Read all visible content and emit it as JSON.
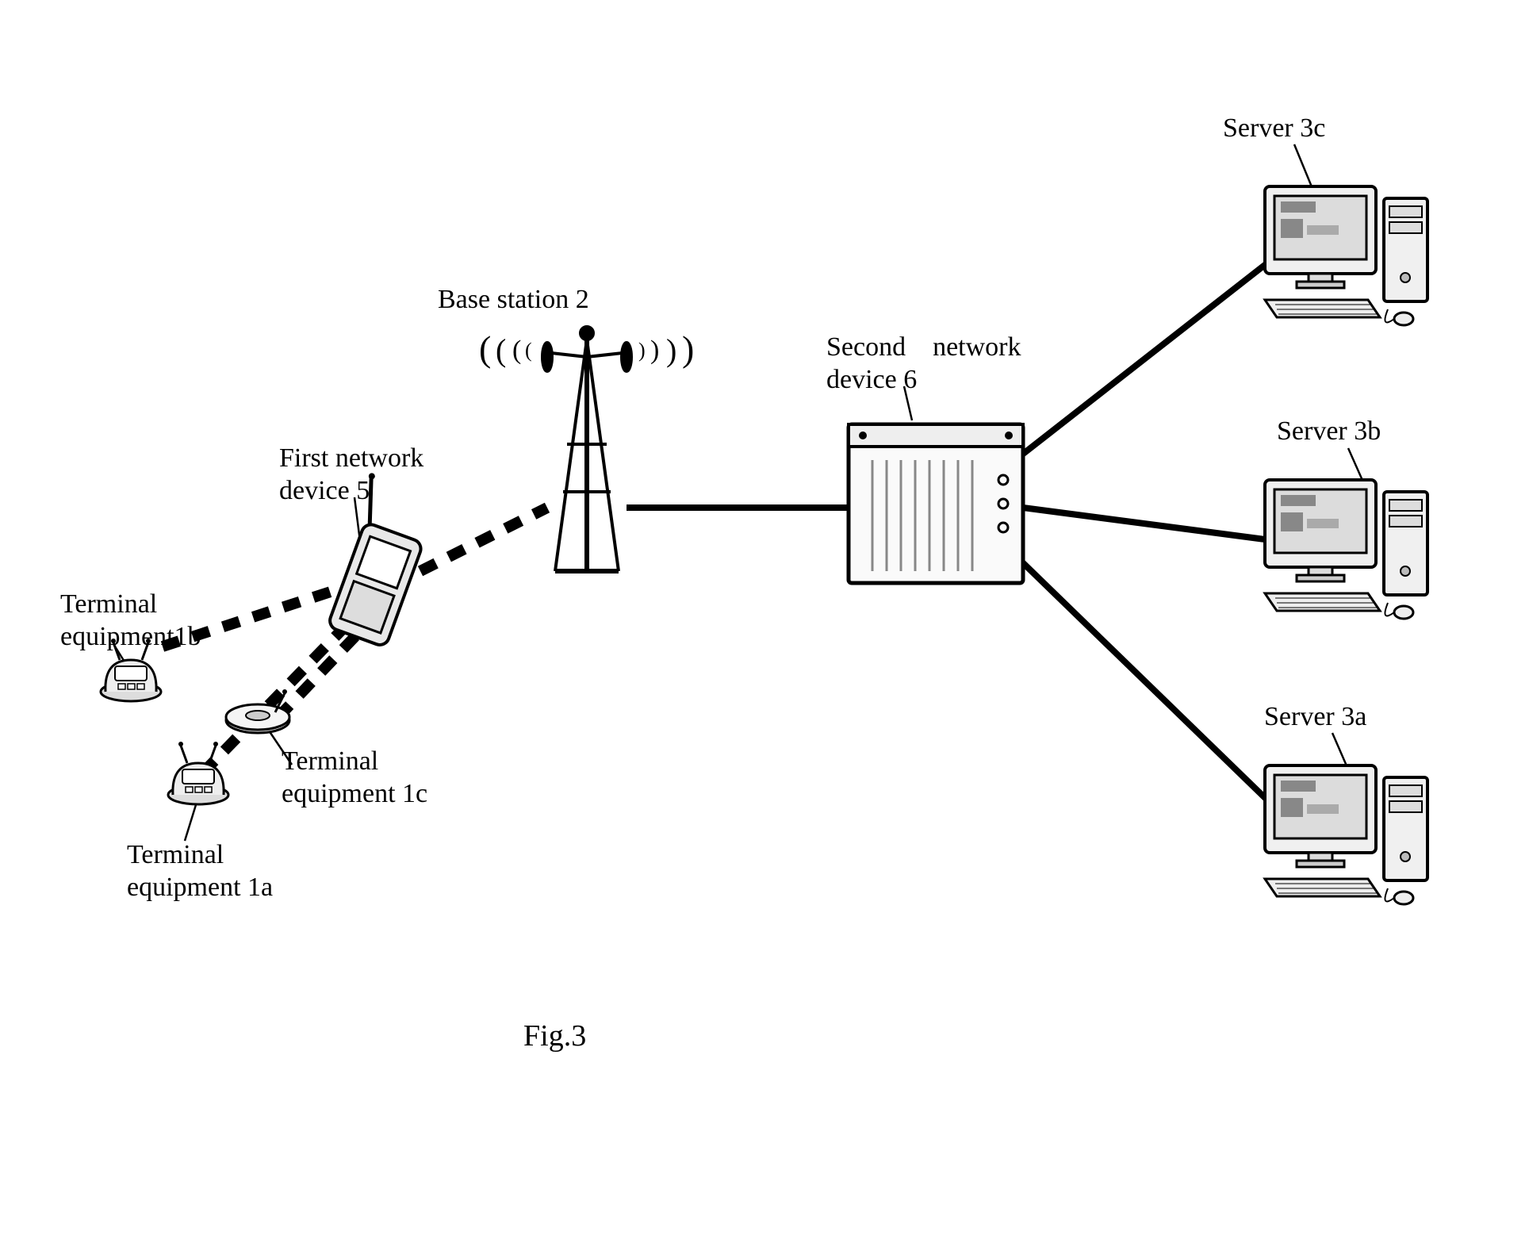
{
  "figure_caption": "Fig.3",
  "nodes": {
    "terminal_1a": {
      "label": "Terminal\nequipment 1a"
    },
    "terminal_1b": {
      "label": "Terminal\nequipment1b"
    },
    "terminal_1c": {
      "label": "Terminal\nequipment 1c"
    },
    "first_network_device": {
      "label": "First network\ndevice 5"
    },
    "base_station": {
      "label": "Base station 2"
    },
    "second_network_device": {
      "label": "Second    network\ndevice 6"
    },
    "server_3a": {
      "label": "Server 3a"
    },
    "server_3b": {
      "label": "Server 3b"
    },
    "server_3c": {
      "label": "Server 3c"
    }
  },
  "links": [
    {
      "from": "terminal_1a",
      "to": "first_network_device",
      "style": "dashed"
    },
    {
      "from": "terminal_1b",
      "to": "first_network_device",
      "style": "dashed"
    },
    {
      "from": "terminal_1c",
      "to": "first_network_device",
      "style": "dashed"
    },
    {
      "from": "first_network_device",
      "to": "base_station",
      "style": "dashed"
    },
    {
      "from": "base_station",
      "to": "second_network_device",
      "style": "solid"
    },
    {
      "from": "second_network_device",
      "to": "server_3a",
      "style": "solid"
    },
    {
      "from": "second_network_device",
      "to": "server_3b",
      "style": "solid"
    },
    {
      "from": "second_network_device",
      "to": "server_3c",
      "style": "solid"
    }
  ]
}
